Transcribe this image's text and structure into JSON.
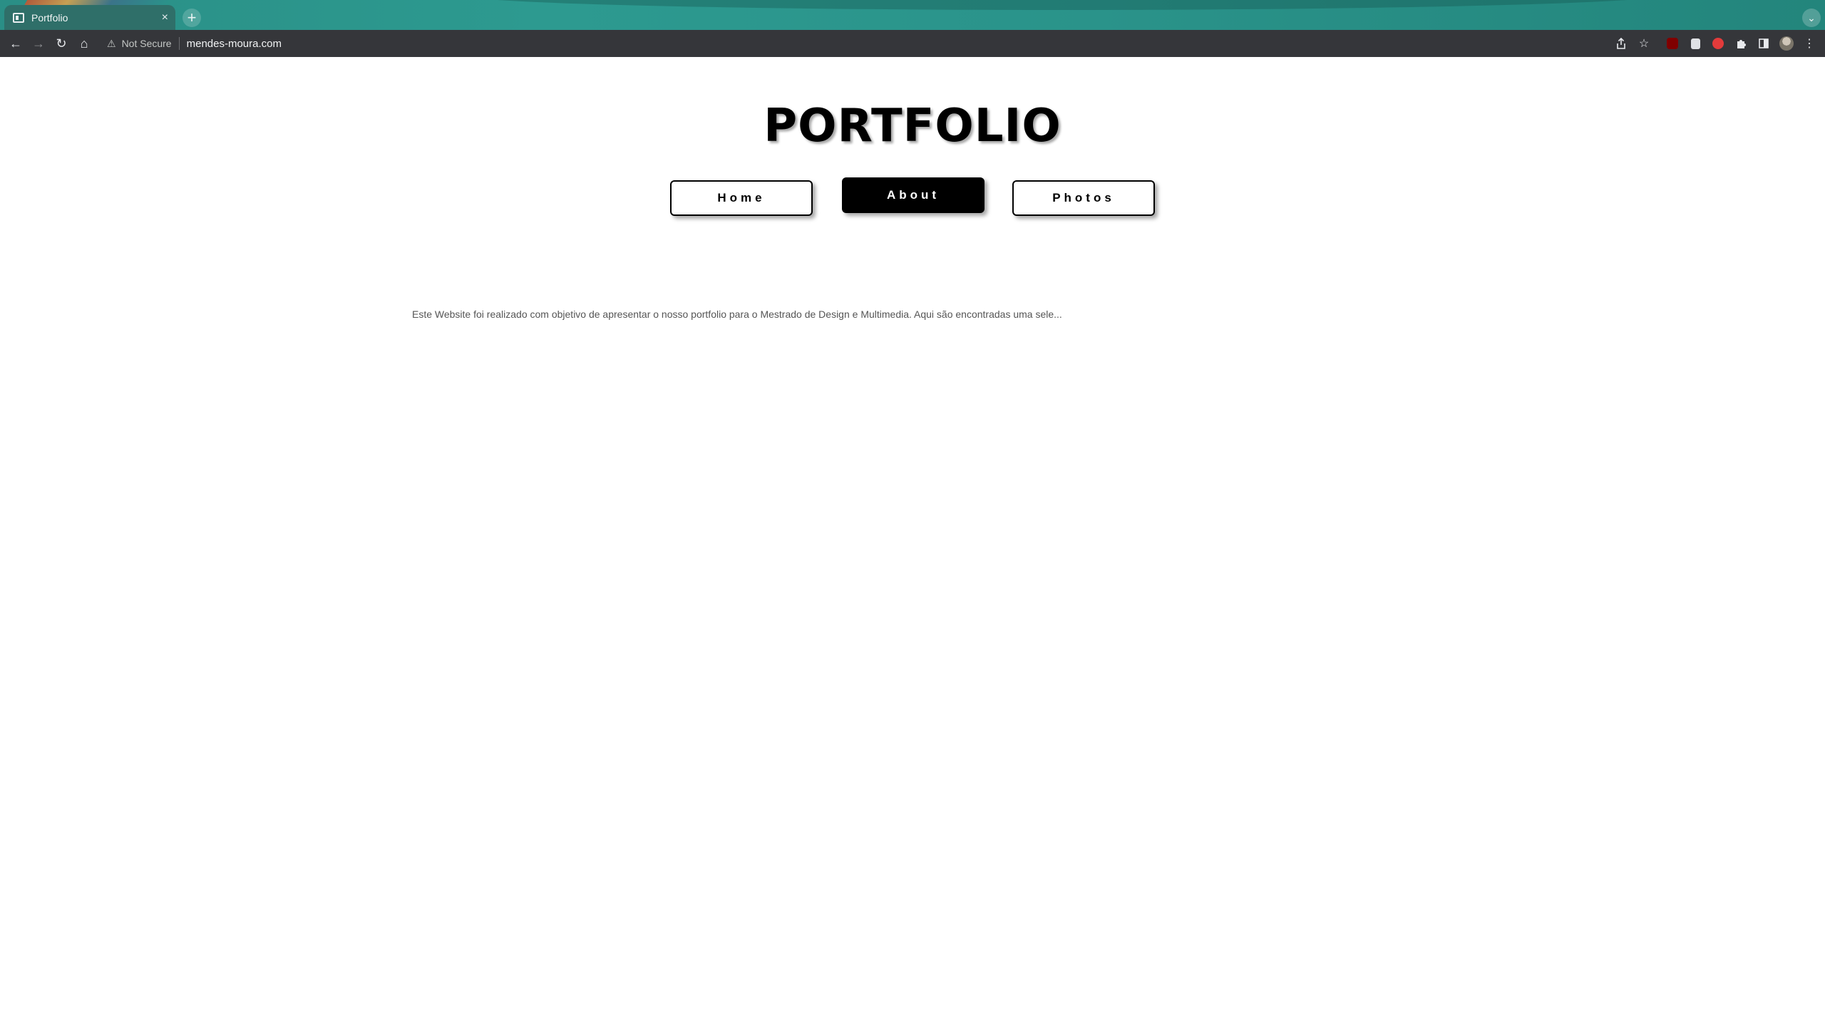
{
  "browser": {
    "tab_title": "Portfolio",
    "tab_close": "×",
    "new_tab": "+",
    "tab_search": "⌄",
    "security_label": "Not Secure",
    "url": "mendes-moura.com",
    "nav": {
      "back": "←",
      "forward": "→",
      "reload": "↻",
      "home": "⌂"
    },
    "icons": [
      "share-icon",
      "bookmark-star-icon",
      "ublock-extension-icon",
      "bitwarden-extension-icon",
      "red-extension-icon",
      "puzzle-extensions-icon",
      "side-panel-icon",
      "profile-avatar",
      "kebab-menu-icon"
    ],
    "colors": {
      "tabstrip": "#2a938a",
      "toolbar": "#35363a"
    }
  },
  "page": {
    "title": "PORTFOLIO",
    "nav": {
      "home": "Home",
      "about": "About",
      "photos": "Photos",
      "active": "About"
    },
    "intro": "Este Website foi realizado com objetivo de apresentar o nosso portfolio para o Mestrado de Design e Multimedia. Aqui são encontradas uma sele..."
  }
}
